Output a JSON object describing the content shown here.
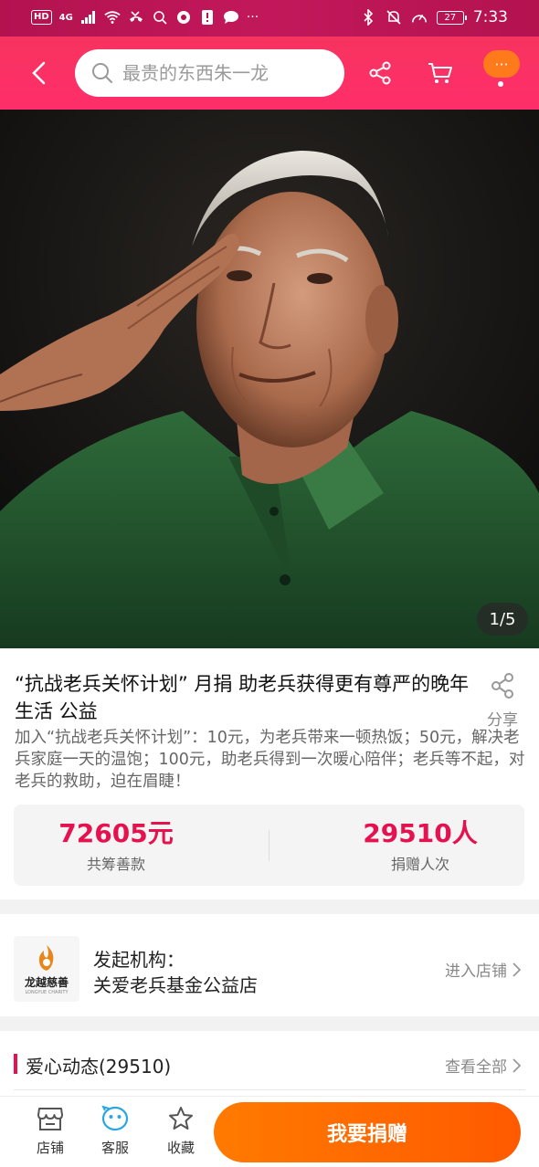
{
  "status_bar": {
    "hd": "HD",
    "network": "4G",
    "battery": "27",
    "time": "7:33"
  },
  "search": {
    "placeholder": "最贵的东西朱一龙"
  },
  "nav": {
    "more_label": "···"
  },
  "hero": {
    "counter": "1/5",
    "image_desc_icon": "veteran-photo"
  },
  "product": {
    "title": "“抗战老兵关怀计划” 月捐 助老兵获得更有尊严的晚年生活 公益",
    "share_label": "分享",
    "description": "加入“抗战老兵关怀计划”：10元，为老兵带来一顿热饭；50元，解决老兵家庭一天的温饱；100元，助老兵得到一次暖心陪伴；老兵等不起，对老兵的救助，迫在眉睫！"
  },
  "stats": {
    "raised_value": "72605元",
    "raised_label": "共筹善款",
    "donors_value": "29510人",
    "donors_label": "捐赠人次"
  },
  "organizer": {
    "logo_brand": "龙越慈善",
    "logo_sub": "LONGYUE CHARITY",
    "label": "发起机构：",
    "name": "关爱老兵基金公益店",
    "enter_shop": "进入店铺"
  },
  "love_updates": {
    "title": "爱心动态(29510)",
    "view_all": "查看全部"
  },
  "bottom_bar": {
    "shop": "店铺",
    "service": "客服",
    "favorite": "收藏",
    "donate": "我要捐赠"
  },
  "colors": {
    "brand_pink": "#ff2e6a",
    "price_red": "#e4134f",
    "donate_orange": "#ff6a00"
  }
}
